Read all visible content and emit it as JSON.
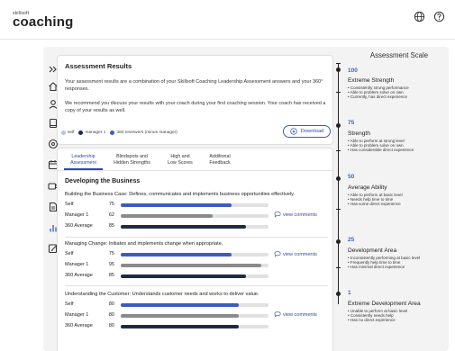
{
  "header": {
    "logo_small": "skillsoft",
    "logo_big": "coaching",
    "icons": [
      "globe-icon",
      "help-icon"
    ]
  },
  "sidebar": {
    "icons": [
      "expand-chevrons-icon",
      "home-icon",
      "profile-icon",
      "notebook-icon",
      "target-icon",
      "calendar-icon",
      "video-icon",
      "document-icon",
      "bar-chart-icon",
      "edit-icon"
    ]
  },
  "results": {
    "title": "Assessment Results",
    "p1": "Your assessment results are a combination of your Skillsoft Coaching Leadership Assessment answers and your 360° responses.",
    "p2": "We recommend you discuss your results with your coach during your first coaching session. Your coach has received a copy of your results as well."
  },
  "legend": [
    {
      "label": "self",
      "color": "#b9c4ea"
    },
    {
      "label": "manager 1",
      "color": "#1f2a44"
    },
    {
      "label": "360 reviewers (minus manager)",
      "color": "#3a5cc1"
    }
  ],
  "download_label": "Download",
  "tabs": [
    {
      "line1": "Leadership",
      "line2": "Assessment",
      "active": true
    },
    {
      "line1": "Blindspots and",
      "line2": "Hidden Strengths",
      "active": false
    },
    {
      "line1": "High and",
      "line2": "Low Scores",
      "active": false
    },
    {
      "line1": "Additional",
      "line2": "Feedback",
      "active": false
    }
  ],
  "section_title": "Developing the Business",
  "view_comments": "view comments",
  "competencies": [
    {
      "title": "Building the Business Case: Defines, communicates and implements business opportunities effectively.",
      "rows": [
        {
          "label": "Self",
          "value": "75",
          "fill": 0.75,
          "color": "#3a5cc1"
        },
        {
          "label": "Manager 1",
          "value": "62",
          "fill": 0.62,
          "color": "#8a8a8a"
        },
        {
          "label": "360 Average",
          "value": "85",
          "fill": 0.85,
          "color": "#1f2a44"
        }
      ]
    },
    {
      "title": "Managing Change: Initiates and implements change when appropriate.",
      "rows": [
        {
          "label": "Self",
          "value": "75",
          "fill": 0.75,
          "color": "#3a5cc1"
        },
        {
          "label": "Manager 1",
          "value": "95",
          "fill": 0.95,
          "color": "#8a8a8a"
        },
        {
          "label": "360 Average",
          "value": "85",
          "fill": 0.85,
          "color": "#1f2a44"
        }
      ]
    },
    {
      "title": "Understanding the Customer: Understands customer needs and works to deliver value.",
      "rows": [
        {
          "label": "Self",
          "value": "80",
          "fill": 0.8,
          "color": "#3a5cc1"
        },
        {
          "label": "Manager 1",
          "value": "80",
          "fill": 0.8,
          "color": "#8a8a8a"
        },
        {
          "label": "360 Average",
          "value": "80",
          "fill": 0.8,
          "color": "#1f2a44"
        }
      ]
    }
  ],
  "scale": {
    "title": "Assessment Scale",
    "levels": [
      {
        "num": "100",
        "name": "Extreme Strength",
        "bullets": [
          "• Consistently strong performance",
          "• Able to problem solve on own",
          "• Currently, has direct experience"
        ]
      },
      {
        "num": "75",
        "name": "Strength",
        "bullets": [
          "• Able to perform at strong level",
          "• Able to problem solve on own",
          "• Has considerable direct experience"
        ]
      },
      {
        "num": "50",
        "name": "Average Ability",
        "bullets": [
          "• Able to perform at basic level",
          "• Needs help time to time",
          "• Has some direct experience"
        ]
      },
      {
        "num": "25",
        "name": "Development Area",
        "bullets": [
          "• Inconsistently performing at basic level",
          "• Frequently help time to time",
          "• Has minimal direct experience"
        ]
      },
      {
        "num": "1",
        "name": "Extreme Development Area",
        "bullets": [
          "• Unable to perform at basic level",
          "• Consistently needs help",
          "• Has no direct experience"
        ]
      }
    ]
  }
}
